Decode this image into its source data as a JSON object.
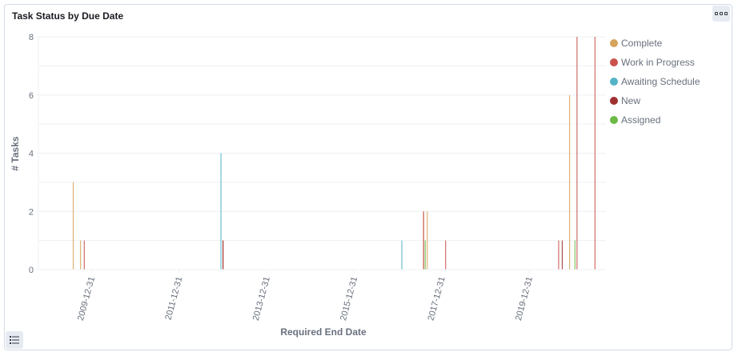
{
  "panel": {
    "title": "Task Status by Due Date"
  },
  "icons": {
    "menu": "options-icon",
    "legend_toggle": "list-icon"
  },
  "chart_data": {
    "type": "bar",
    "title": "Task Status by Due Date",
    "xlabel": "Required End Date",
    "ylabel": "# Tasks",
    "ylim": [
      0,
      8
    ],
    "yticks": [
      0,
      2,
      4,
      6,
      8
    ],
    "xlim": [
      "2008-10-15",
      "2021-10-01"
    ],
    "xticks": [
      "2009-12-31",
      "2011-12-31",
      "2013-12-31",
      "2015-12-31",
      "2017-12-31",
      "2019-12-31"
    ],
    "grid": true,
    "legend_position": "right",
    "series": [
      {
        "name": "Complete",
        "color": "#d6a35c",
        "points": [
          {
            "x": "2009-08-01",
            "y": 3
          },
          {
            "x": "2009-10-01",
            "y": 1
          },
          {
            "x": "2017-08-01",
            "y": 2
          },
          {
            "x": "2017-09-01",
            "y": 2
          },
          {
            "x": "2020-12-01",
            "y": 6
          }
        ]
      },
      {
        "name": "Work in Progress",
        "color": "#c9524d",
        "points": [
          {
            "x": "2009-11-01",
            "y": 1
          },
          {
            "x": "2013-01-01",
            "y": 1
          },
          {
            "x": "2017-08-01",
            "y": 2
          },
          {
            "x": "2018-02-01",
            "y": 1
          },
          {
            "x": "2020-09-01",
            "y": 1
          },
          {
            "x": "2021-02-01",
            "y": 8
          },
          {
            "x": "2021-07-01",
            "y": 8
          }
        ]
      },
      {
        "name": "Awaiting Schedule",
        "color": "#54b3c7",
        "points": [
          {
            "x": "2012-12-15",
            "y": 4
          },
          {
            "x": "2017-02-01",
            "y": 1
          }
        ]
      },
      {
        "name": "New",
        "color": "#a03030",
        "points": [
          {
            "x": "2013-01-01",
            "y": 1
          },
          {
            "x": "2020-10-01",
            "y": 1
          }
        ]
      },
      {
        "name": "Assigned",
        "color": "#6cba45",
        "points": [
          {
            "x": "2017-08-15",
            "y": 1
          },
          {
            "x": "2021-01-15",
            "y": 1
          }
        ]
      }
    ]
  }
}
